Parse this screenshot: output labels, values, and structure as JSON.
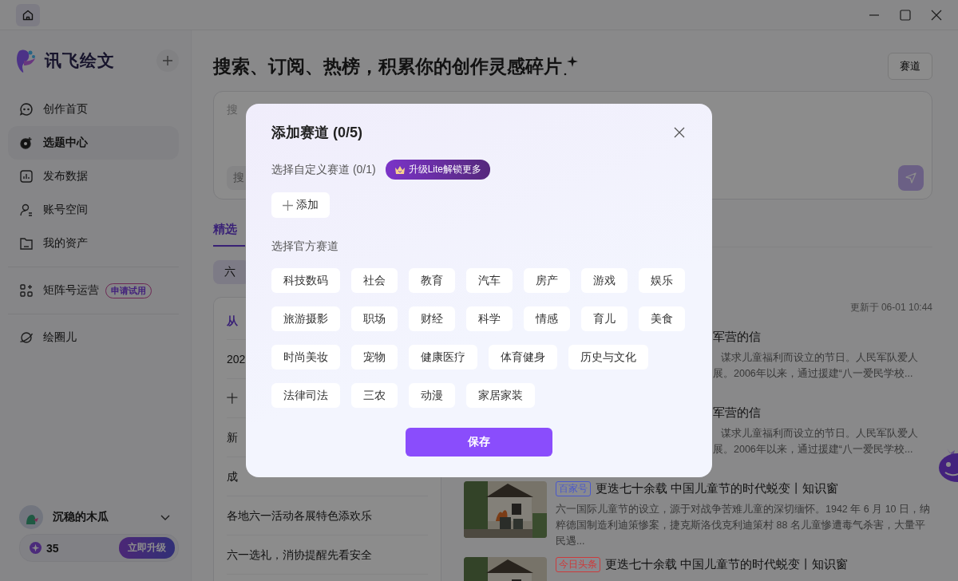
{
  "app": {
    "name": "讯飞绘文"
  },
  "sidebar": {
    "items": [
      {
        "label": "创作首页",
        "selected": false
      },
      {
        "label": "选题中心",
        "selected": true
      },
      {
        "label": "发布数据",
        "selected": false
      },
      {
        "label": "账号空间",
        "selected": false
      },
      {
        "label": "我的资产",
        "selected": false
      }
    ],
    "matrix": {
      "label": "矩阵号运营",
      "badge": "申请试用"
    },
    "circle": {
      "label": "绘圈儿"
    },
    "user": {
      "name": "沉稳的木瓜",
      "points": "35",
      "upgrade": "立即升级"
    }
  },
  "header": {
    "title": "搜索、订阅、热榜，积累你的创作灵感碎片",
    "track_button": "赛道"
  },
  "search": {
    "placeholder": "搜",
    "sub_placeholder": "搜"
  },
  "tabs": [
    {
      "label": "精选",
      "selected": true
    }
  ],
  "chip": "六",
  "topic_list": [
    {
      "text": "从",
      "kind": "head"
    },
    {
      "text": "202",
      "kind": "item"
    },
    {
      "text": "十",
      "kind": "item"
    },
    {
      "text": "新",
      "kind": "item"
    },
    {
      "text": "成",
      "kind": "item"
    },
    {
      "text": "各地六一活动各展特色添欢乐",
      "kind": "item"
    },
    {
      "text": "六一选礼，消协提醒先看安全",
      "kind": "item"
    }
  ],
  "updated": "更新于 06-01 10:44",
  "news": [
    {
      "kind": "partial",
      "title": "军营的信",
      "lines": [
        "谋求儿童福利而设立的节日。人民军队爱人",
        "展。2006年以来，通过援建“八一爱民学校..."
      ]
    },
    {
      "kind": "partial",
      "title": "军营的信",
      "lines": [
        "谋求儿童福利而设立的节日。人民军队爱人",
        "展。2006年以来，通过援建“八一爱民学校..."
      ]
    },
    {
      "kind": "full",
      "tag": "百家号",
      "color": "#4857cc",
      "title": "更迭七十余载 中国儿童节的时代蜕变丨知识窗",
      "desc": "六一国际儿童节的设立，源于对战争苦难儿童的深切缅怀。1942 年 6 月 10 日，纳粹德国制造利迪策惨案，捷克斯洛伐克利迪策村 88 名儿童惨遭毒气杀害，大量平民遇..."
    },
    {
      "kind": "full",
      "tag": "今日头条",
      "color": "#cc3b3b",
      "title": "更迭七十余载 中国儿童节的时代蜕变丨知识窗"
    }
  ],
  "modal": {
    "title": "添加赛道 (0/5)",
    "custom_label": "选择自定义赛道 (0/1)",
    "upgrade_badge": "升级Lite解锁更多",
    "add_button": "添加",
    "official_label": "选择官方赛道",
    "tracks": [
      [
        "科技数码",
        "社会",
        "教育",
        "汽车",
        "房产",
        "游戏",
        "娱乐"
      ],
      [
        "旅游摄影",
        "职场",
        "财经",
        "科学",
        "情感",
        "育儿",
        "美食"
      ],
      [
        "时尚美妆",
        "宠物",
        "健康医疗",
        "体育健身",
        "历史与文化"
      ],
      [
        "法律司法",
        "三农",
        "动漫",
        "家居家装"
      ]
    ],
    "save_button": "保存"
  }
}
